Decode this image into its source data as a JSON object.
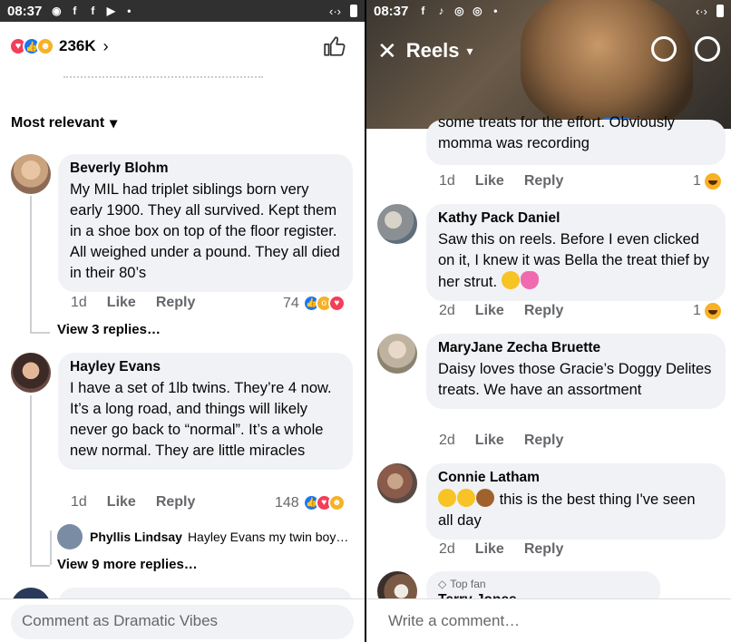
{
  "left": {
    "status": {
      "time": "08:37"
    },
    "reactions": {
      "count": "236K"
    },
    "sort_label": "Most relevant",
    "comments": [
      {
        "name": "Beverly Blohm",
        "text": "My MIL had triplet siblings  born very early 1900. They all survived. Kept them in a shoe box on top of the floor register. All weighed under a pound. They all died in their 80’s",
        "time": "1d",
        "like": "Like",
        "reply": "Reply",
        "reaction_count": "74",
        "view_replies": "View 3 replies…"
      },
      {
        "name": "Hayley Evans",
        "text": "I have a set of 1lb twins. They’re 4 now. It’s a long road, and things will likely never go back to “normal”. It’s a whole new normal. They are little miracles",
        "time": "1d",
        "like": "Like",
        "reply": "Reply",
        "reaction_count": "148",
        "reply_preview_name": "Phyllis Lindsay",
        "reply_preview_text": "Hayley Evans my twin boy…",
        "view_replies": "View 9 more replies…"
      }
    ],
    "composer_placeholder": "Comment as Dramatic Vibes"
  },
  "right": {
    "status": {
      "time": "08:37"
    },
    "header_title": "Reels",
    "partial_top": {
      "line1": "some treats for the effort. Obviously",
      "line2": "momma was recording",
      "time": "1d",
      "like": "Like",
      "reply": "Reply",
      "reaction_count": "1"
    },
    "comments": [
      {
        "name": "Kathy Pack Daniel",
        "text": "Saw this on reels. Before I even clicked on it, I knew it was Bella the treat thief by her strut.",
        "time": "2d",
        "like": "Like",
        "reply": "Reply",
        "reaction_count": "1"
      },
      {
        "name": "MaryJane Zecha Bruette",
        "text": "Daisy loves those Gracie’s Doggy Delites treats. We have an assortment",
        "time": "2d",
        "like": "Like",
        "reply": "Reply"
      },
      {
        "name": "Connie Latham",
        "text": "this is the best thing I've seen all day",
        "time": "2d",
        "like": "Like",
        "reply": "Reply"
      }
    ],
    "partial_bottom": {
      "badge": "Top fan",
      "name": "Terry Jones"
    },
    "composer_placeholder": "Write a comment…"
  },
  "colors": {
    "like_blue": "#1877f2",
    "heart_red": "#f33e58",
    "bubble_gray": "#f0f2f5",
    "meta_gray": "#65676b"
  }
}
